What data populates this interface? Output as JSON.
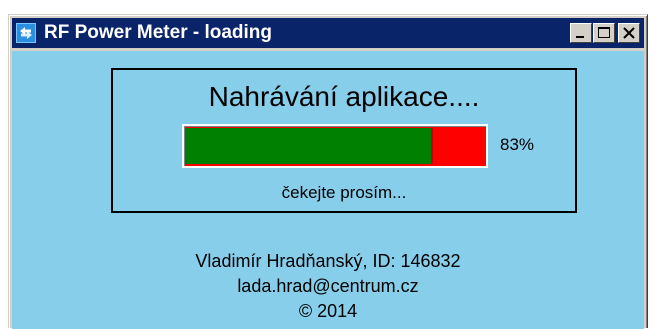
{
  "window": {
    "title": "RF Power Meter - loading",
    "app_icon": "rf-meter-app-icon",
    "buttons": {
      "minimize_icon": "minimize-icon",
      "maximize_icon": "maximize-icon",
      "close_icon": "close-icon"
    },
    "colors": {
      "titlebar": "#0a246a",
      "client_background": "#87ceeb"
    }
  },
  "loading": {
    "heading": "Nahrávání aplikace....",
    "progress_percent": 83,
    "progress_label": "83%",
    "wait_text": "čekejte prosím...",
    "colors": {
      "filled": "#008000",
      "remaining": "#ff0000"
    }
  },
  "credits": {
    "author": "Vladimír Hradňanský, ID: 146832",
    "email": "lada.hrad@centrum.cz",
    "copyright": "© 2014"
  }
}
